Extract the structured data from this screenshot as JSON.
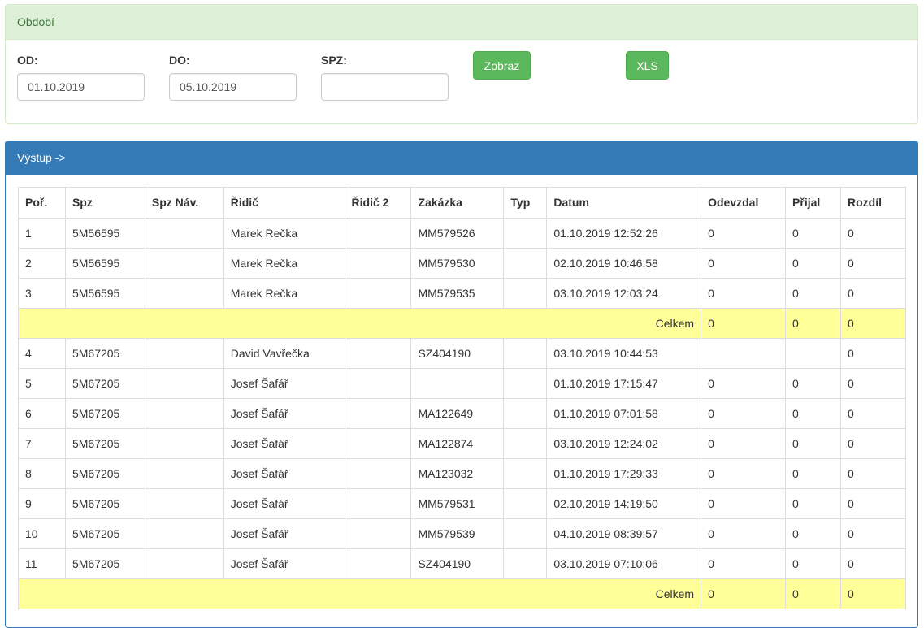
{
  "filter": {
    "heading": "Období",
    "od_label": "OD:",
    "od_value": "01.10.2019",
    "do_label": "DO:",
    "do_value": "05.10.2019",
    "spz_label": "SPZ:",
    "spz_value": "",
    "show_button": "Zobraz",
    "xls_button": "XLS"
  },
  "output": {
    "heading": "Výstup ->",
    "columns": [
      "Poř.",
      "Spz",
      "Spz Náv.",
      "Řidič",
      "Řidič 2",
      "Zakázka",
      "Typ",
      "Datum",
      "Odevzdal",
      "Přijal",
      "Rozdíl"
    ],
    "rows": [
      {
        "kind": "row",
        "cells": [
          "1",
          "5M56595",
          "",
          "Marek Rečka",
          "",
          "MM579526",
          "",
          "01.10.2019 12:52:26",
          "0",
          "0",
          "0"
        ]
      },
      {
        "kind": "row",
        "cells": [
          "2",
          "5M56595",
          "",
          "Marek Rečka",
          "",
          "MM579530",
          "",
          "02.10.2019 10:46:58",
          "0",
          "0",
          "0"
        ]
      },
      {
        "kind": "row",
        "cells": [
          "3",
          "5M56595",
          "",
          "Marek Rečka",
          "",
          "MM579535",
          "",
          "03.10.2019 12:03:24",
          "0",
          "0",
          "0"
        ]
      },
      {
        "kind": "total",
        "label": "Celkem",
        "cells": [
          "0",
          "0",
          "0"
        ]
      },
      {
        "kind": "row",
        "cells": [
          "4",
          "5M67205",
          "",
          "David Vavřečka",
          "",
          "SZ404190",
          "",
          "03.10.2019 10:44:53",
          "",
          "",
          "0"
        ]
      },
      {
        "kind": "row",
        "cells": [
          "5",
          "5M67205",
          "",
          "Josef Šafář",
          "",
          "",
          "",
          "01.10.2019 17:15:47",
          "0",
          "0",
          "0"
        ]
      },
      {
        "kind": "row",
        "cells": [
          "6",
          "5M67205",
          "",
          "Josef Šafář",
          "",
          "MA122649",
          "",
          "01.10.2019 07:01:58",
          "0",
          "0",
          "0"
        ]
      },
      {
        "kind": "row",
        "cells": [
          "7",
          "5M67205",
          "",
          "Josef Šafář",
          "",
          "MA122874",
          "",
          "03.10.2019 12:24:02",
          "0",
          "0",
          "0"
        ]
      },
      {
        "kind": "row",
        "cells": [
          "8",
          "5M67205",
          "",
          "Josef Šafář",
          "",
          "MA123032",
          "",
          "01.10.2019 17:29:33",
          "0",
          "0",
          "0"
        ]
      },
      {
        "kind": "row",
        "cells": [
          "9",
          "5M67205",
          "",
          "Josef Šafář",
          "",
          "MM579531",
          "",
          "02.10.2019 14:19:50",
          "0",
          "0",
          "0"
        ]
      },
      {
        "kind": "row",
        "cells": [
          "10",
          "5M67205",
          "",
          "Josef Šafář",
          "",
          "MM579539",
          "",
          "04.10.2019 08:39:57",
          "0",
          "0",
          "0"
        ]
      },
      {
        "kind": "row",
        "cells": [
          "11",
          "5M67205",
          "",
          "Josef Šafář",
          "",
          "SZ404190",
          "",
          "03.10.2019 07:10:06",
          "0",
          "0",
          "0"
        ]
      },
      {
        "kind": "total",
        "label": "Celkem",
        "cells": [
          "0",
          "0",
          "0"
        ]
      }
    ]
  },
  "colors": {
    "success_bg": "#dff0d8",
    "success_text": "#3c763d",
    "primary": "#337ab7",
    "button_green": "#5cb85c",
    "total_row": "#ffff99"
  }
}
